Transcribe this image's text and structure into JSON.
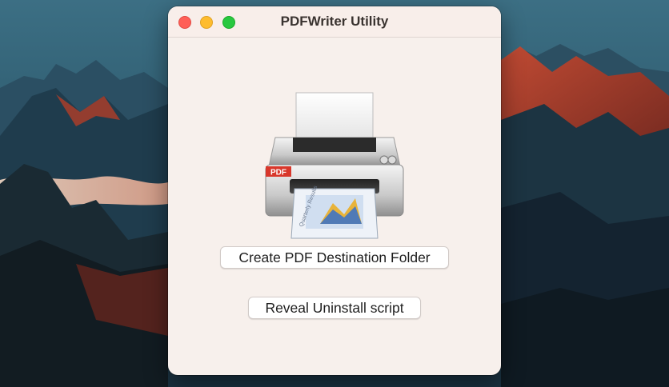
{
  "window": {
    "title": "PDFWriter Utility"
  },
  "printer_icon": {
    "badge": "PDF",
    "paper_text": "Quarterly Results"
  },
  "buttons": {
    "create_folder": "Create PDF Destination Folder",
    "reveal_uninstall": "Reveal Uninstall script"
  }
}
